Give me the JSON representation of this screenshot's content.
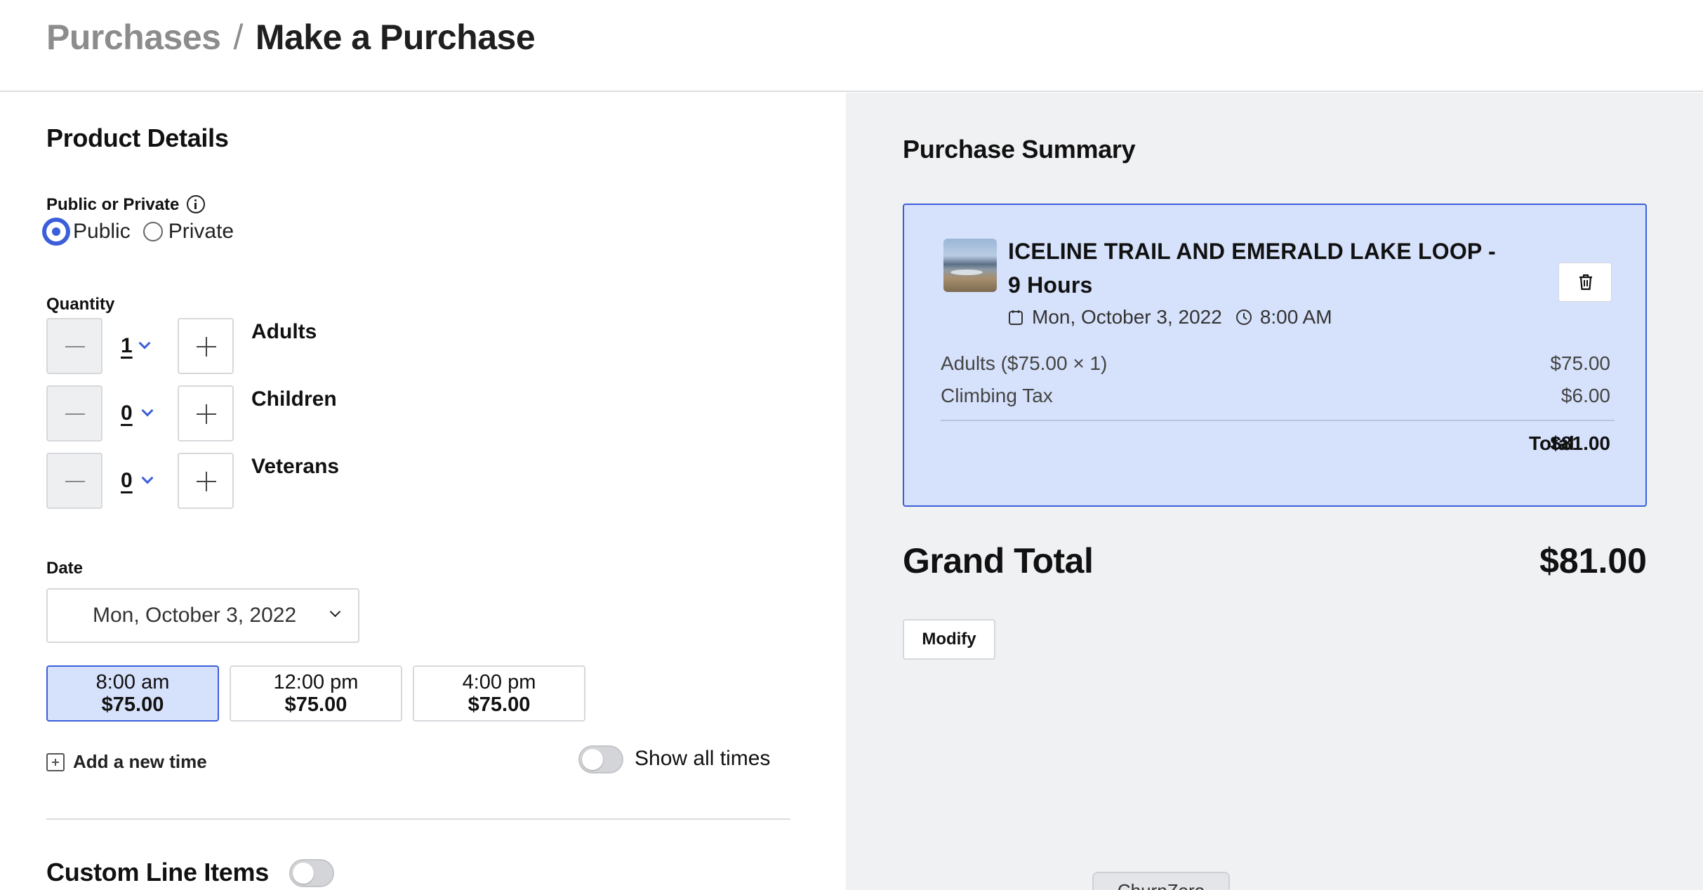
{
  "breadcrumb": {
    "parent": "Purchases",
    "separator": "/",
    "current": "Make a Purchase"
  },
  "product_details": {
    "title": "Product Details",
    "visibility": {
      "label": "Public or Private",
      "options": [
        "Public",
        "Private"
      ],
      "selected": "Public"
    },
    "quantity": {
      "label": "Quantity",
      "rows": [
        {
          "value": "1",
          "label": "Adults"
        },
        {
          "value": "0",
          "label": "Children"
        },
        {
          "value": "0",
          "label": "Veterans"
        }
      ]
    },
    "date": {
      "label": "Date",
      "value": "Mon, October 3, 2022"
    },
    "time_slots": [
      {
        "time": "8:00 am",
        "price": "$75.00",
        "selected": true
      },
      {
        "time": "12:00 pm",
        "price": "$75.00",
        "selected": false
      },
      {
        "time": "4:00 pm",
        "price": "$75.00",
        "selected": false
      }
    ],
    "add_time_label": "Add a new time",
    "show_all_times_label": "Show all times",
    "custom_line_items_title": "Custom Line Items"
  },
  "summary": {
    "title": "Purchase Summary",
    "item": {
      "name": "ICELINE TRAIL AND EMERALD LAKE LOOP - 9 Hours",
      "date": "Mon, October 3, 2022",
      "time": "8:00 AM",
      "lines": [
        {
          "label": "Adults ($75.00 × 1)",
          "value": "$75.00"
        },
        {
          "label": "Climbing Tax",
          "value": "$6.00"
        }
      ],
      "total_label": "Total",
      "total_value": "$81.00"
    },
    "grand_total_label": "Grand Total",
    "grand_total_value": "$81.00",
    "modify_label": "Modify"
  },
  "widget_tab": "ChurnZero",
  "colors": {
    "accent": "#3b5fd9",
    "selected_bg": "#d6e1fb",
    "panel_bg": "#f0f1f3"
  }
}
